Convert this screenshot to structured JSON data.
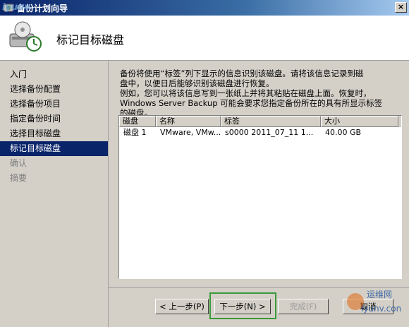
{
  "window": {
    "title": "备份计划向导"
  },
  "header": {
    "title": "标记目标磁盘"
  },
  "nav": {
    "items": [
      {
        "label": "入门",
        "state": "normal"
      },
      {
        "label": "选择备份配置",
        "state": "normal"
      },
      {
        "label": "选择备份项目",
        "state": "normal"
      },
      {
        "label": "指定备份时间",
        "state": "normal"
      },
      {
        "label": "选择目标磁盘",
        "state": "normal"
      },
      {
        "label": "标记目标磁盘",
        "state": "active"
      },
      {
        "label": "确认",
        "state": "disabled"
      },
      {
        "label": "摘要",
        "state": "disabled"
      }
    ]
  },
  "main": {
    "description_lines": [
      "备份将使用“标签”列下显示的信息识别该磁盘。请将该信息记录到磁",
      "盘中，以便日后能够识别该磁盘进行恢复。",
      "例如，您可以将该信息写到一张纸上并将其粘贴在磁盘上面。恢复时，",
      "Windows Server Backup 可能会要求您指定备份所在的具有所显示标签",
      "的磁盘。"
    ],
    "table": {
      "headers": [
        "磁盘",
        "名称",
        "标签",
        "大小"
      ],
      "rows": [
        [
          "磁盘 1",
          "VMware, VMw...",
          "s0000 2011_07_11 1...",
          "40.00 GB"
        ]
      ]
    }
  },
  "buttons": {
    "back": "< 上一步(P)",
    "next": "下一步(N) >",
    "finish": "完成(F)",
    "cancel": "取消"
  },
  "watermark": {
    "top": "iyunv",
    "bottom_top": "运维网",
    "bottom": "iyunv.com"
  },
  "colors": {
    "highlight": "#3a9a3a",
    "nav_active": "#0a246a"
  }
}
